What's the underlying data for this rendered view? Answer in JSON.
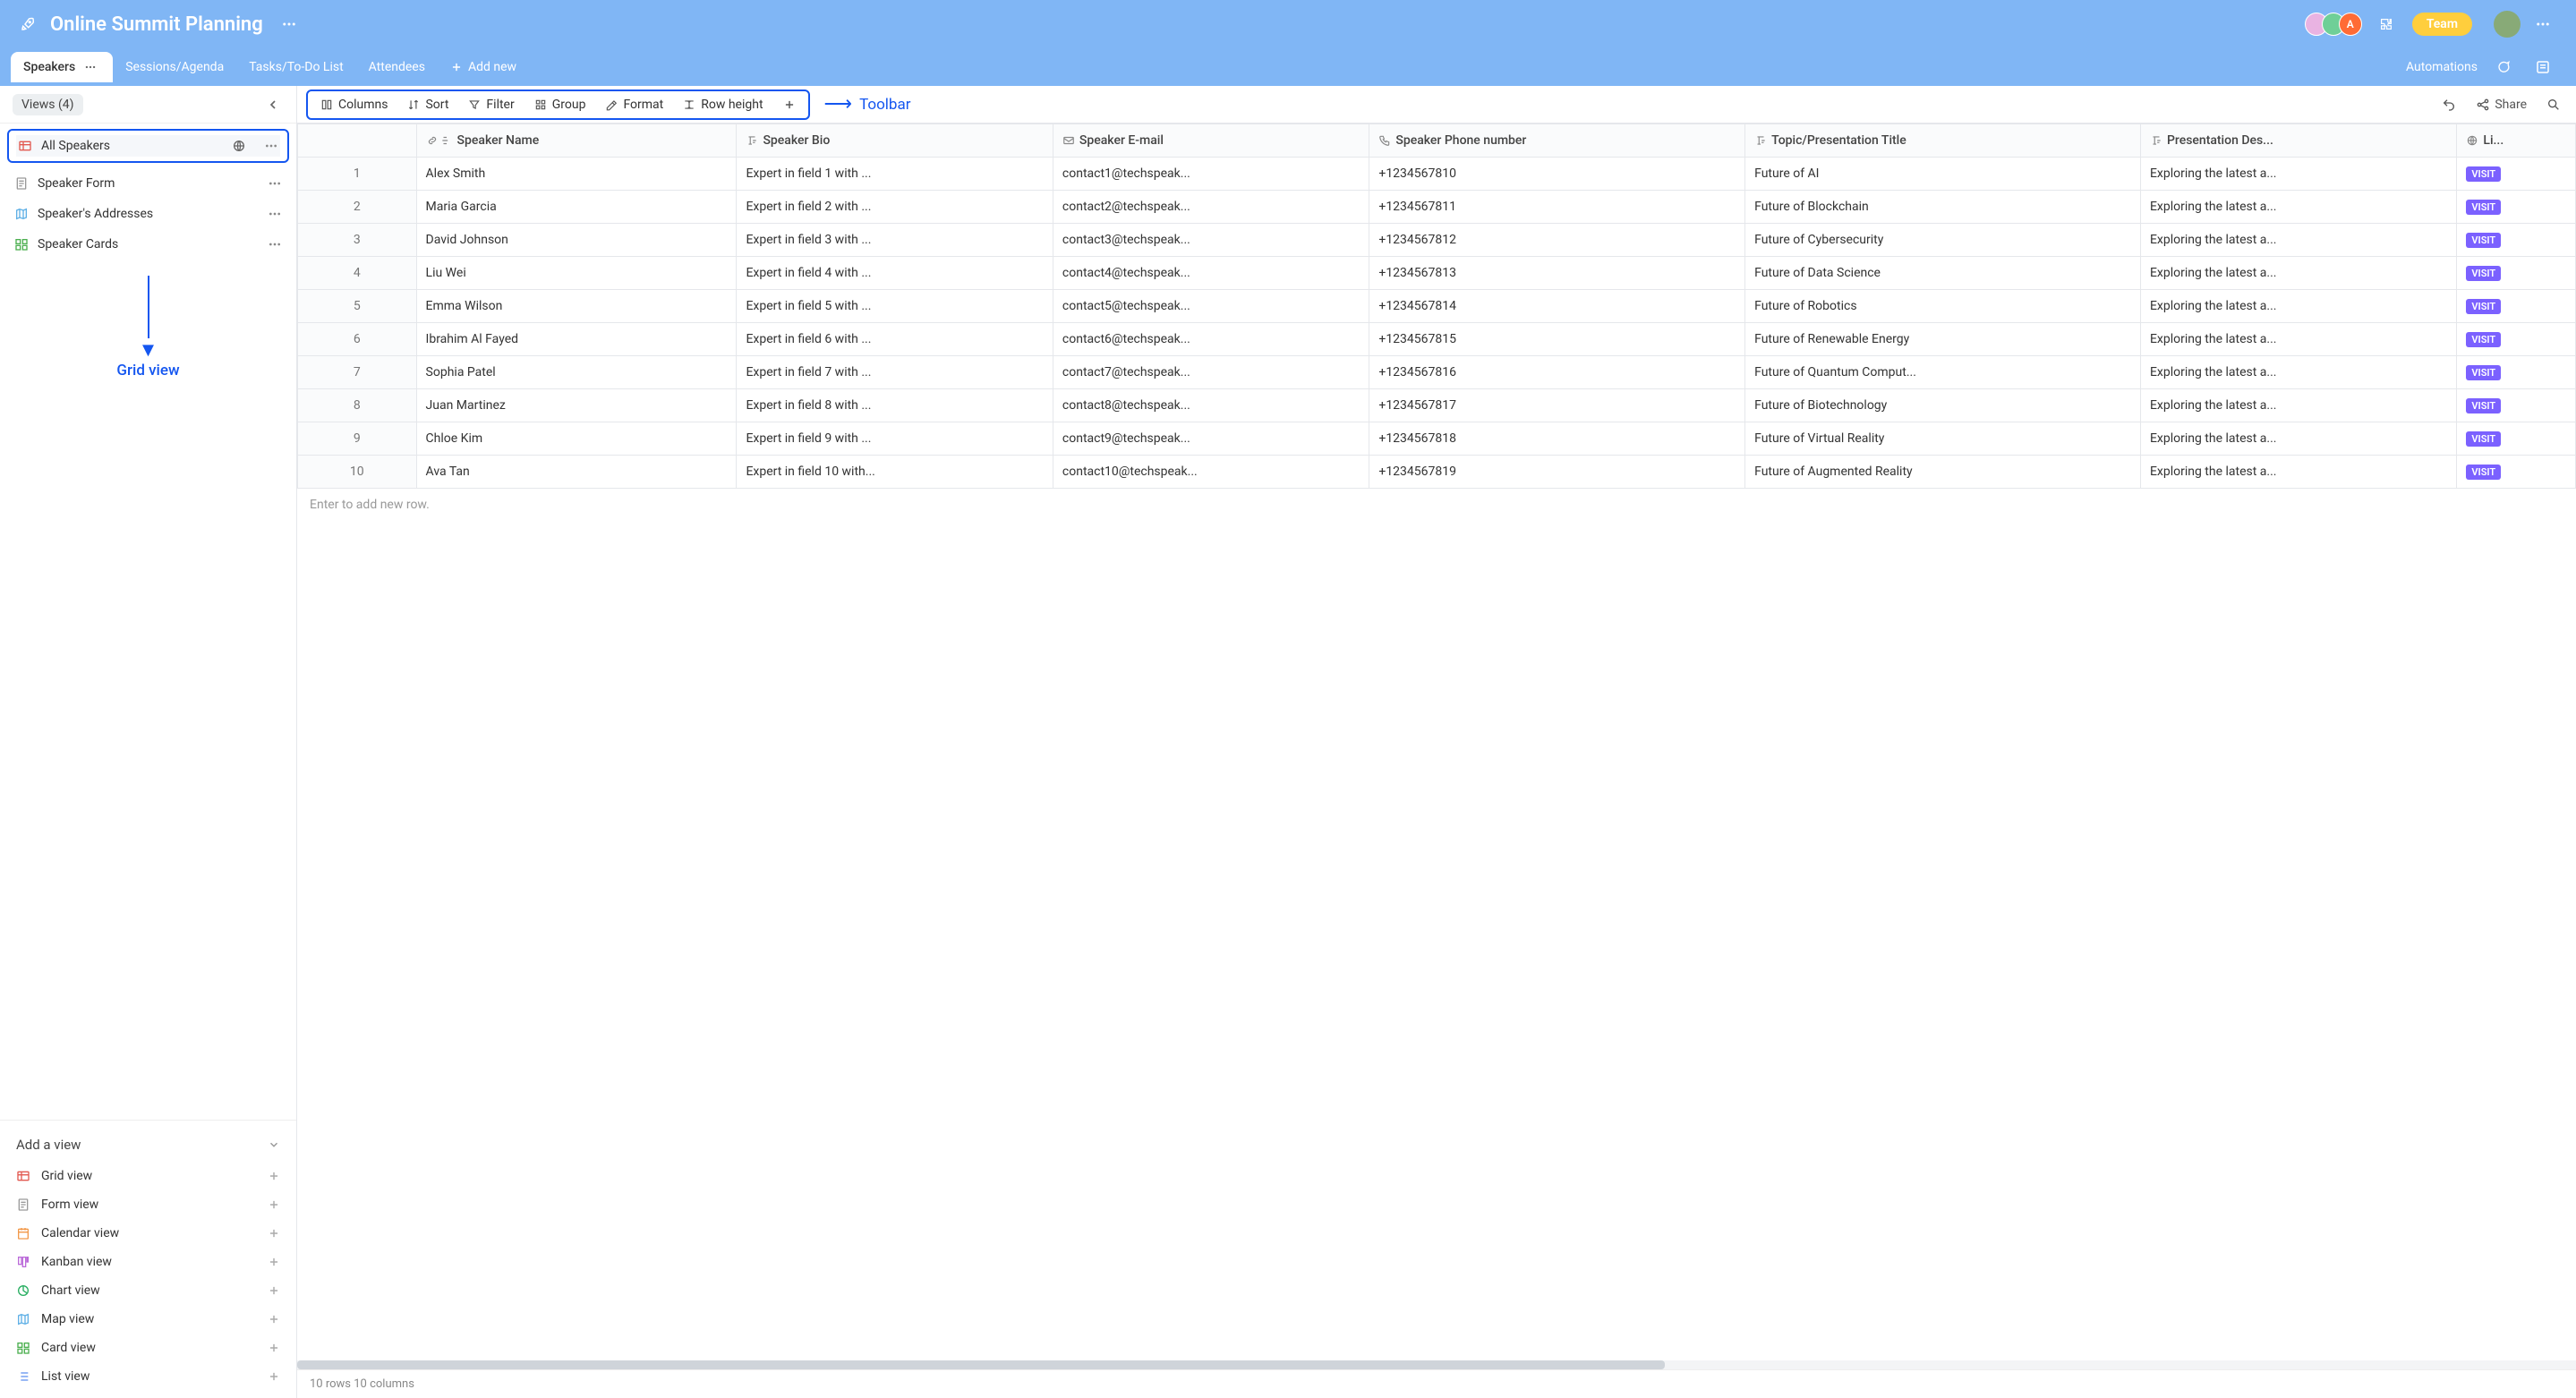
{
  "header": {
    "title": "Online Summit Planning",
    "avatars": [
      {
        "bg": "#e9b3e2",
        "label": ""
      },
      {
        "bg": "#6fcf97",
        "label": ""
      },
      {
        "bg": "#ff6b35",
        "label": "A"
      }
    ],
    "team_label": "Team"
  },
  "tabs": {
    "items": [
      "Speakers",
      "Sessions/Agenda",
      "Tasks/To-Do List",
      "Attendees"
    ],
    "add_new": "Add new",
    "automations": "Automations"
  },
  "views_header": "Views (4)",
  "views": {
    "selected": {
      "name": "All Speakers",
      "icon": "grid",
      "color": "#e25950"
    },
    "others": [
      {
        "name": "Speaker Form",
        "icon": "form",
        "color": "#999"
      },
      {
        "name": "Speaker's Addresses",
        "icon": "map",
        "color": "#5fb0e6"
      },
      {
        "name": "Speaker Cards",
        "icon": "cards",
        "color": "#4caf50"
      }
    ]
  },
  "annotations": {
    "grid_view": "Grid view",
    "toolbar": "Toolbar"
  },
  "add_view": {
    "header": "Add a view",
    "items": [
      {
        "name": "Grid view",
        "color": "#e25950"
      },
      {
        "name": "Form view",
        "color": "#999"
      },
      {
        "name": "Calendar view",
        "color": "#f2994a"
      },
      {
        "name": "Kanban view",
        "color": "#bb6bd9"
      },
      {
        "name": "Chart view",
        "color": "#27ae60"
      },
      {
        "name": "Map view",
        "color": "#5fb0e6"
      },
      {
        "name": "Card view",
        "color": "#4caf50"
      },
      {
        "name": "List view",
        "color": "#5b8def"
      }
    ]
  },
  "toolbar": {
    "columns": "Columns",
    "sort": "Sort",
    "filter": "Filter",
    "group": "Group",
    "format": "Format",
    "row_height": "Row height",
    "share": "Share"
  },
  "columns": [
    {
      "label": "Speaker Name",
      "icon": "link-text"
    },
    {
      "label": "Speaker Bio",
      "icon": "text"
    },
    {
      "label": "Speaker E-mail",
      "icon": "mail"
    },
    {
      "label": "Speaker Phone number",
      "icon": "phone"
    },
    {
      "label": "Topic/Presentation Title",
      "icon": "text"
    },
    {
      "label": "Presentation Des...",
      "icon": "text"
    },
    {
      "label": "Li...",
      "icon": "globe"
    }
  ],
  "rows": [
    {
      "n": 1,
      "name": "Alex Smith",
      "bio": "Expert in field 1 with ...",
      "mail": "contact1@techspeak...",
      "phone": "+1234567810",
      "topic": "Future of AI",
      "desc": "Exploring the latest a...",
      "link": "VISIT"
    },
    {
      "n": 2,
      "name": "Maria Garcia",
      "bio": "Expert in field 2 with ...",
      "mail": "contact2@techspeak...",
      "phone": "+1234567811",
      "topic": "Future of Blockchain",
      "desc": "Exploring the latest a...",
      "link": "VISIT"
    },
    {
      "n": 3,
      "name": "David Johnson",
      "bio": "Expert in field 3 with ...",
      "mail": "contact3@techspeak...",
      "phone": "+1234567812",
      "topic": "Future of Cybersecurity",
      "desc": "Exploring the latest a...",
      "link": "VISIT"
    },
    {
      "n": 4,
      "name": "Liu Wei",
      "bio": "Expert in field 4 with ...",
      "mail": "contact4@techspeak...",
      "phone": "+1234567813",
      "topic": "Future of Data Science",
      "desc": "Exploring the latest a...",
      "link": "VISIT"
    },
    {
      "n": 5,
      "name": "Emma Wilson",
      "bio": "Expert in field 5 with ...",
      "mail": "contact5@techspeak...",
      "phone": "+1234567814",
      "topic": "Future of Robotics",
      "desc": "Exploring the latest a...",
      "link": "VISIT"
    },
    {
      "n": 6,
      "name": "Ibrahim Al Fayed",
      "bio": "Expert in field 6 with ...",
      "mail": "contact6@techspeak...",
      "phone": "+1234567815",
      "topic": "Future of Renewable Energy",
      "desc": "Exploring the latest a...",
      "link": "VISIT"
    },
    {
      "n": 7,
      "name": "Sophia Patel",
      "bio": "Expert in field 7 with ...",
      "mail": "contact7@techspeak...",
      "phone": "+1234567816",
      "topic": "Future of Quantum Comput...",
      "desc": "Exploring the latest a...",
      "link": "VISIT"
    },
    {
      "n": 8,
      "name": "Juan Martinez",
      "bio": "Expert in field 8 with ...",
      "mail": "contact8@techspeak...",
      "phone": "+1234567817",
      "topic": "Future of Biotechnology",
      "desc": "Exploring the latest a...",
      "link": "VISIT"
    },
    {
      "n": 9,
      "name": "Chloe Kim",
      "bio": "Expert in field 9 with ...",
      "mail": "contact9@techspeak...",
      "phone": "+1234567818",
      "topic": "Future of Virtual Reality",
      "desc": "Exploring the latest a...",
      "link": "VISIT"
    },
    {
      "n": 10,
      "name": "Ava Tan",
      "bio": "Expert in field 10 with...",
      "mail": "contact10@techspeak...",
      "phone": "+1234567819",
      "topic": "Future of Augmented Reality",
      "desc": "Exploring the latest a...",
      "link": "VISIT"
    }
  ],
  "add_row": "Enter to add new row.",
  "status": "10 rows  10 columns"
}
